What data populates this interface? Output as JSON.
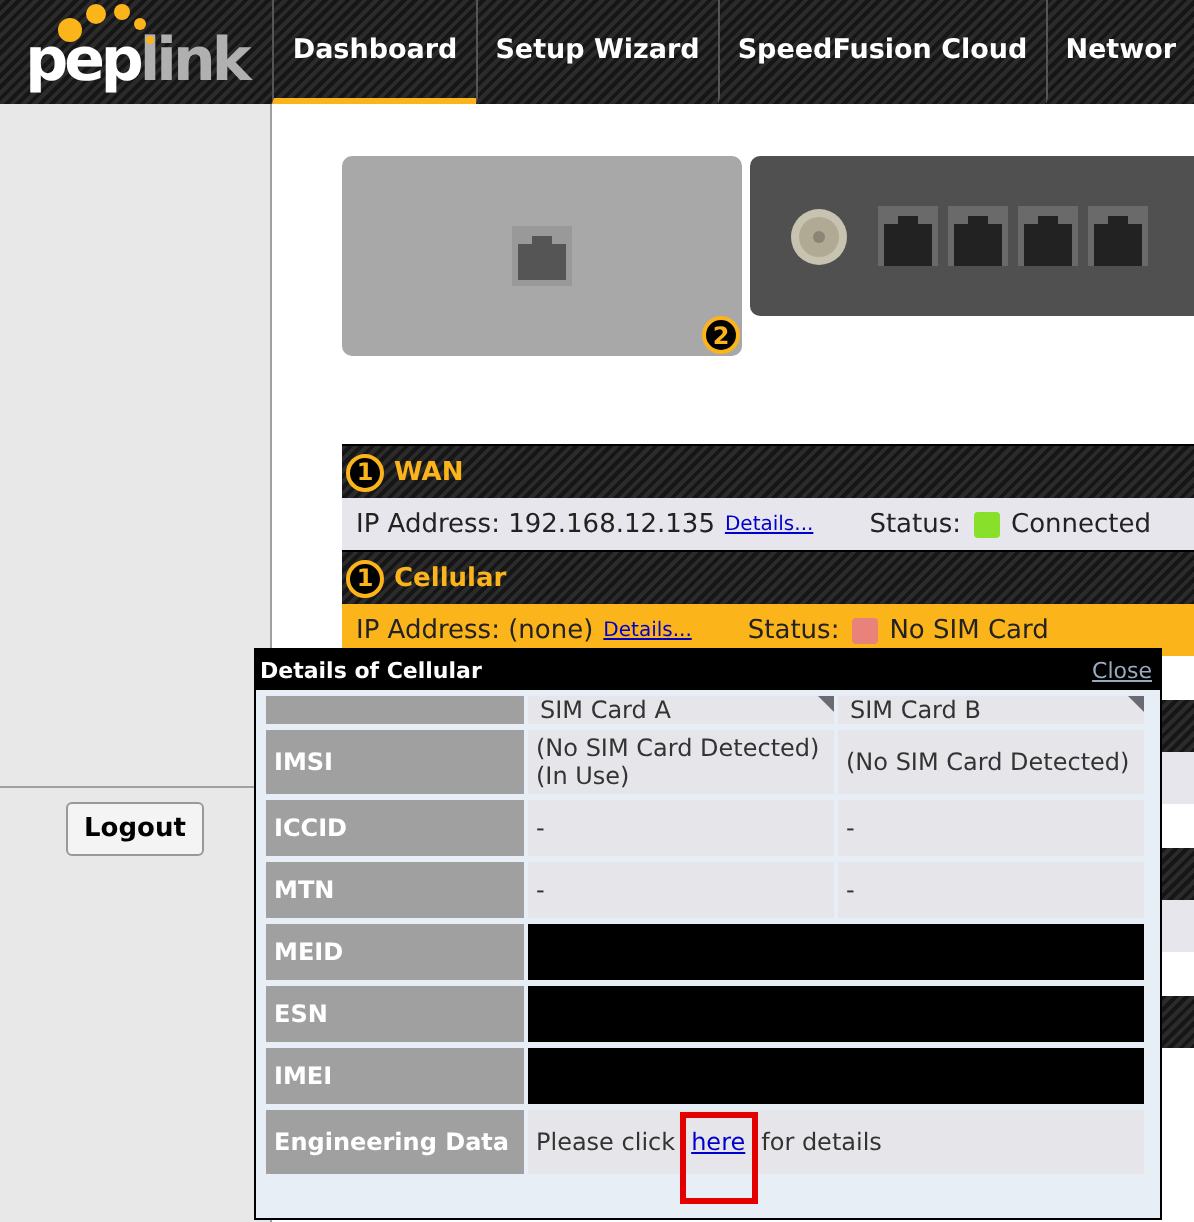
{
  "header": {
    "logo": [
      "pep",
      "link"
    ],
    "tabs": [
      {
        "label": "Dashboard",
        "selected": true
      },
      {
        "label": "Setup Wizard",
        "selected": false
      },
      {
        "label": "SpeedFusion Cloud",
        "selected": false
      },
      {
        "label": "Networ",
        "selected": false
      }
    ]
  },
  "sidebar": {
    "logout": "Logout"
  },
  "device": {
    "badge": "2"
  },
  "connections": [
    {
      "badge": "1",
      "name": "WAN",
      "ip_label": "IP Address:",
      "ip": "192.168.12.135",
      "details": "Details...",
      "status_label": "Status:",
      "online": true,
      "status": "Connected",
      "highlighted": false
    },
    {
      "badge": "1",
      "name": "Cellular",
      "ip_label": "IP Address:",
      "ip": "(none)",
      "details": "Details...",
      "status_label": "Status:",
      "online": false,
      "status": "No SIM Card",
      "highlighted": true
    }
  ],
  "popup": {
    "title": "Details of Cellular",
    "close": "Close",
    "columns": [
      "SIM Card A",
      "SIM Card B"
    ],
    "rows": [
      {
        "kind": "text",
        "label": "IMSI",
        "values": [
          "(No SIM Card Detected) (In Use)",
          "(No SIM Card Detected)"
        ]
      },
      {
        "kind": "text",
        "label": "ICCID",
        "values": [
          "-",
          "-"
        ]
      },
      {
        "kind": "text",
        "label": "MTN",
        "values": [
          "-",
          "-"
        ]
      },
      {
        "kind": "redacted",
        "label": "MEID"
      },
      {
        "kind": "redacted",
        "label": "ESN"
      },
      {
        "kind": "redacted",
        "label": "IMEI"
      },
      {
        "kind": "link",
        "label": "Engineering Data",
        "before": "Please click",
        "link": "here",
        "after": "for details",
        "highlighted": true
      }
    ]
  }
}
